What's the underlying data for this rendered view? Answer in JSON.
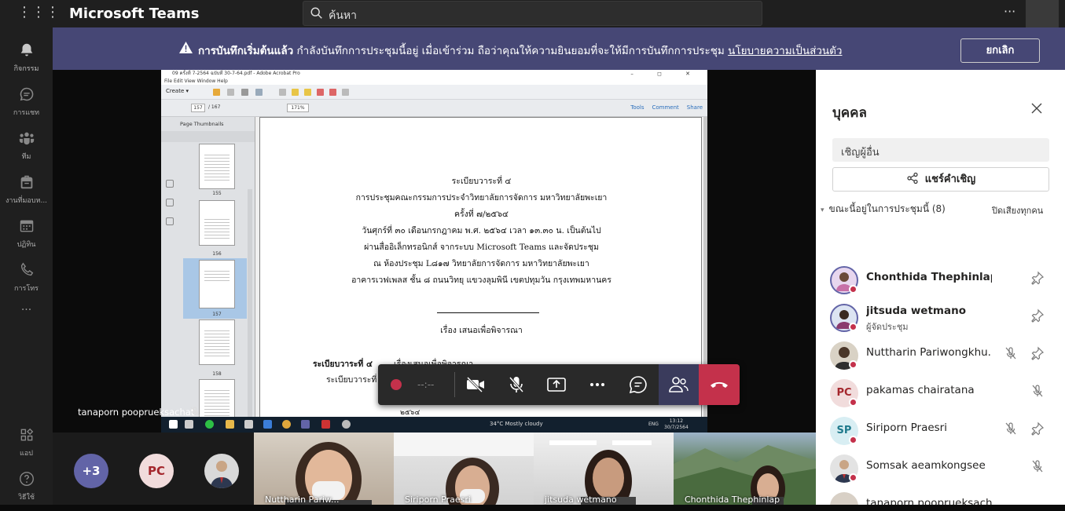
{
  "app": {
    "title": "Microsoft Teams",
    "search_placeholder": "ค้นหา",
    "more": "···"
  },
  "rail": [
    {
      "id": "activity",
      "label": "กิจกรรม"
    },
    {
      "id": "chat",
      "label": "การแชท"
    },
    {
      "id": "teams",
      "label": "ทีม"
    },
    {
      "id": "assignments",
      "label": "งานที่มอบห..."
    },
    {
      "id": "calendar",
      "label": "ปฏิทิน"
    },
    {
      "id": "calls",
      "label": "การโทร"
    },
    {
      "id": "more",
      "label": "···"
    },
    {
      "id": "apps",
      "label": "แอป"
    },
    {
      "id": "help",
      "label": "วิธีใช้"
    }
  ],
  "banner": {
    "bold": "การบันทึกเริ่มต้นแล้ว",
    "text": " กำลังบันทึกการประชุมนี้อยู่ เมื่อเข้าร่วม ถือว่าคุณให้ความยินยอมที่จะให้มีการบันทึกการประชุม ",
    "link": "นโยบายความเป็นส่วนตัว",
    "cancel": "ยกเลิก"
  },
  "acrobat": {
    "title": "09 ครั้งที่ 7-2564 ฉบับที่ 30-7-64.pdf - Adobe Acrobat Pro",
    "window_buttons": "– ◻ ✕",
    "menu": "File  Edit  View  Window  Help",
    "create": "Create ▾",
    "page": "157",
    "page_total": "/ 167",
    "zoom": "171%",
    "tools": "Tools",
    "comment": "Comment",
    "share": "Share",
    "thumb_header": "Page Thumbnails",
    "thumb_numbers": [
      "155",
      "156",
      "157",
      "158"
    ]
  },
  "document": {
    "lines": [
      "ระเบียบวาระที่ ๔",
      "การประชุมคณะกรรมการประจำวิทยาลัยการจัดการ มหาวิทยาลัยพะเยา",
      "ครั้งที่ ๗/๒๕๖๔",
      "วันศุกร์ที่ ๓๐ เดือนกรกฎาคม พ.ศ. ๒๕๖๔ เวลา ๑๓.๓๐ น. เป็นต้นไป",
      "ผ่านสื่ออิเล็กทรอนิกส์ จากระบบ Microsoft Teams และจัดประชุม",
      "ณ ห้องประชุม L๘๑๗ วิทยาลัยการจัดการ มหาวิทยาลัยพะเยา",
      "อาคารเวฟเพลส ชั้น ๘ ถนนวิทยุ แขวงลุมพินี เขตปทุมวัน กรุงเทพมหานคร"
    ],
    "subject": "เรื่อง เสนอเพื่อพิจารณา",
    "agenda_label": "ระเบียบวาระที่ ๔",
    "agenda_subject": "เรื่องเสนอเพื่อพิจารณา",
    "agenda_sub": "ระเบียบวาระที่ ๔",
    "footer": "๒๕๖๔"
  },
  "taskbar": {
    "weather": "34°C  Mostly cloudy",
    "lang": "ENG",
    "time": "13:12",
    "date": "30/7/2564"
  },
  "presenter": {
    "name": "tanaporn pooprueksachat"
  },
  "controls": {
    "timer": "--:--"
  },
  "people_panel": {
    "title": "บุคคล",
    "invite_placeholder": "เชิญผู้อื่น",
    "share_invite": "แชร์คำเชิญ",
    "section": "ขณะนี้อยู่ในการประชุมนี้ (8)",
    "mute_all": "ปิดเสียงทุกคน",
    "participants": [
      {
        "name": "Chonthida Thephinlap",
        "initials": "",
        "role": "",
        "bold": true
      },
      {
        "name": "jitsuda wetmano",
        "initials": "",
        "role": "ผู้จัดประชุม",
        "bold": true
      },
      {
        "name": "Nuttharin Pariwongkhu...",
        "initials": "",
        "role": "",
        "bold": false
      },
      {
        "name": "pakamas chairatana",
        "initials": "PC",
        "role": "",
        "bold": false
      },
      {
        "name": "Siriporn Praesri",
        "initials": "SP",
        "role": "",
        "bold": false
      },
      {
        "name": "Somsak aeamkongsee",
        "initials": "",
        "role": "",
        "bold": false
      },
      {
        "name": "tanaporn pooprueksachat",
        "initials": "",
        "role": "",
        "bold": false
      }
    ]
  },
  "gallery": {
    "overflow": "+3",
    "pc_initials": "PC",
    "tiles": [
      {
        "name": "Nuttharin Pariw..."
      },
      {
        "name": "Siriporn Praesri"
      },
      {
        "name": "jitsuda wetmano"
      },
      {
        "name": "Chonthida Thephinlap"
      }
    ]
  },
  "colors": {
    "accent": "#464775",
    "hangup": "#c4314b",
    "rail": "#1f1f1f"
  }
}
